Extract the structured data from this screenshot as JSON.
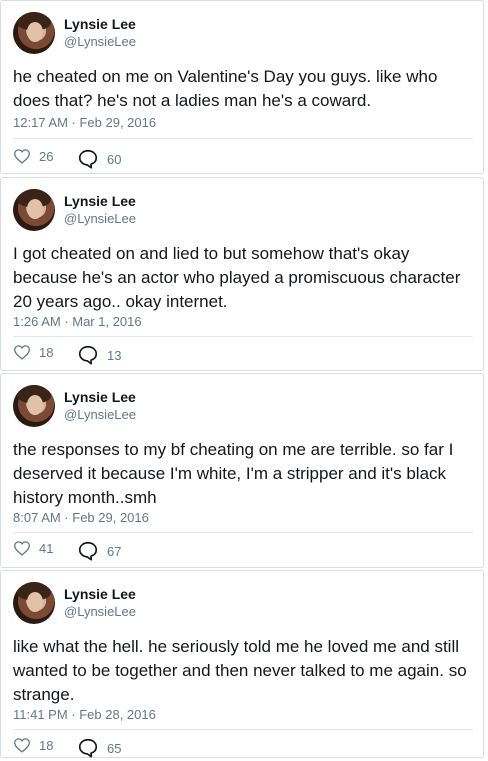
{
  "tweets": [
    {
      "name": "Lynsie Lee",
      "handle": "@LynsieLee",
      "text": "he cheated on me on Valentine's Day you guys. like who does that? he's not a ladies man he's a coward.",
      "time": "12:17 AM · Feb 29, 2016",
      "likes": "26",
      "replies": "60"
    },
    {
      "name": "Lynsie Lee",
      "handle": "@LynsieLee",
      "text": "I got cheated on and lied to but somehow that's okay because he's an actor who played a promiscuous character 20 years ago.. okay internet.",
      "time": "1:26 AM · Mar 1, 2016",
      "likes": "18",
      "replies": "13"
    },
    {
      "name": "Lynsie Lee",
      "handle": "@LynsieLee",
      "text": "the responses to my bf cheating on me are terrible. so far I deserved it because I'm white, I'm a stripper and it's black history month..smh",
      "time": "8:07 AM · Feb 29, 2016",
      "likes": "41",
      "replies": "67"
    },
    {
      "name": "Lynsie Lee",
      "handle": "@LynsieLee",
      "text": "like what the hell. he seriously told me he loved me and still wanted to be together and then never talked to me again. so strange.",
      "time": "11:41 PM · Feb 28, 2016",
      "likes": "18",
      "replies": "65"
    }
  ],
  "icons": {
    "like": "heart-icon",
    "reply": "reply-bubble-icon"
  },
  "colors": {
    "text": "#14171a",
    "muted": "#657786",
    "border": "#d7dde1"
  }
}
